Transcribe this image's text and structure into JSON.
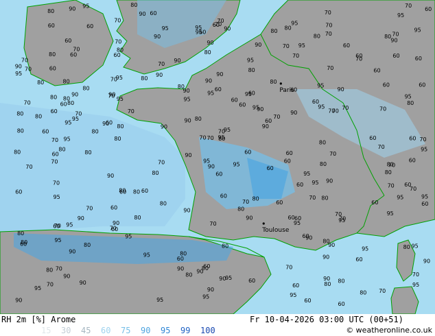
{
  "title": "RH 2m [%] Arome",
  "datetime": "Fr 10-04-2026 03:00 UTC (00+51)",
  "credit": "© weatheronline.co.uk",
  "legend": [
    {
      "label": "15",
      "color": "#dfe6ea"
    },
    {
      "label": "30",
      "color": "#c3ced6"
    },
    {
      "label": "45",
      "color": "#a7b7c2"
    },
    {
      "label": "60",
      "color": "#9fd3ef"
    },
    {
      "label": "75",
      "color": "#76bfe8"
    },
    {
      "label": "90",
      "color": "#4fa5e0"
    },
    {
      "label": "95",
      "color": "#2f86d6"
    },
    {
      "label": "99",
      "color": "#1f62c4"
    },
    {
      "label": "100",
      "color": "#1747b0"
    }
  ],
  "cities": [
    {
      "name": "Paris",
      "lon": 2.35,
      "lat": 48.86
    },
    {
      "name": "Toulouse",
      "lon": 1.44,
      "lat": 43.6
    }
  ],
  "colors": {
    "land": "#a0a0a0",
    "sea": "#a8dcf2",
    "coast": "#00a000",
    "border": "#00a000",
    "label": "#000000"
  },
  "map_extent": {
    "lon_min": -12.5,
    "lon_max": 10.5,
    "lat_min": 40.2,
    "lat_max": 52.0
  }
}
